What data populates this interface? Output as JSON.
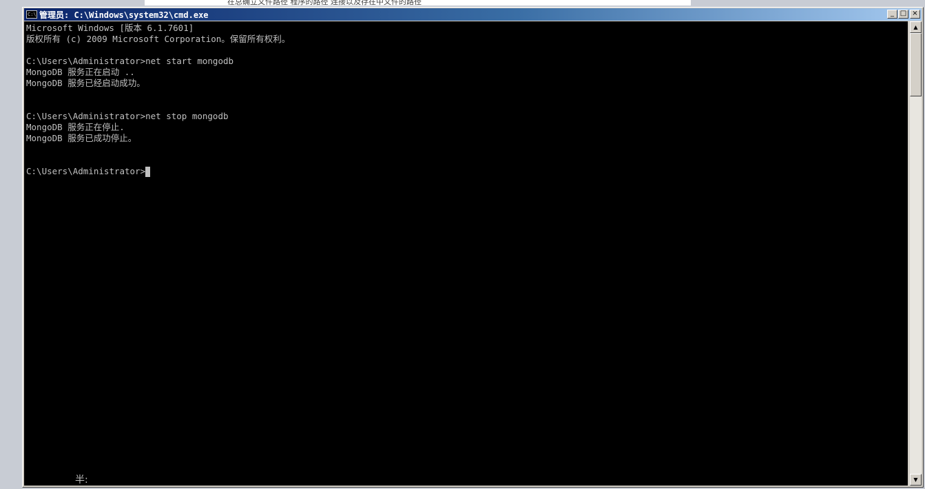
{
  "background": {
    "strip_text": "在总确立文件路径 程序的路径 连接以及存在中文件的路径"
  },
  "window": {
    "title": "管理员: C:\\Windows\\system32\\cmd.exe",
    "icon_label": "C:\\",
    "buttons": {
      "minimize": "_",
      "maximize": "□",
      "close": "×"
    },
    "titlebar_colors": [
      "#0a246a",
      "#a6caf0"
    ]
  },
  "console": {
    "text_color": "#c0c0c0",
    "background": "#000000",
    "lines": [
      "Microsoft Windows [版本 6.1.7601]",
      "版权所有 (c) 2009 Microsoft Corporation。保留所有权利。",
      "",
      "C:\\Users\\Administrator>net start mongodb",
      "MongoDB 服务正在启动 ..",
      "MongoDB 服务已经启动成功。",
      "",
      "",
      "C:\\Users\\Administrator>net stop mongodb",
      "MongoDB 服务正在停止.",
      "MongoDB 服务已成功停止。",
      "",
      "",
      "C:\\Users\\Administrator>"
    ],
    "ime_status": "半:"
  },
  "scrollbar": {
    "up_arrow": "▲",
    "down_arrow": "▼"
  }
}
